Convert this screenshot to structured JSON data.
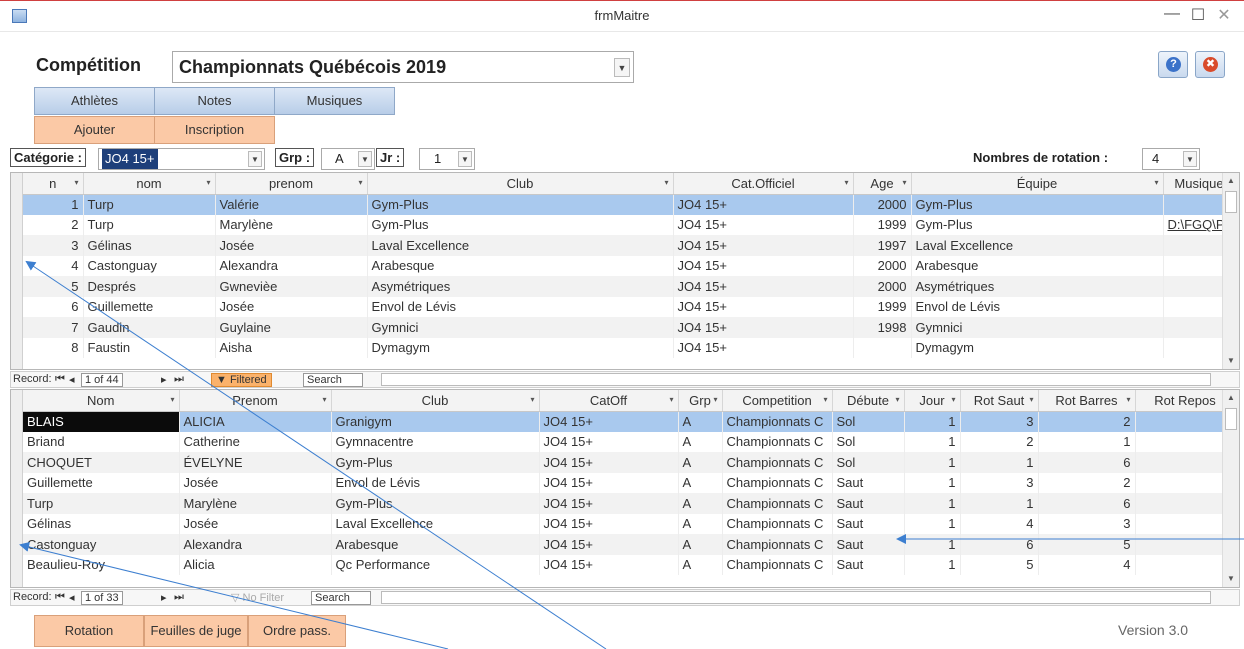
{
  "window": {
    "title": "frmMaitre",
    "minimize": "—",
    "maximize": "☐",
    "close": "✕"
  },
  "header": {
    "competition_label": "Compétition",
    "competition_value": "Championnats Québécois 2019",
    "help_icon": "?",
    "close_icon": "✖"
  },
  "buttons": {
    "athletes": "Athlètes",
    "notes": "Notes",
    "musiques": "Musiques",
    "ajouter": "Ajouter",
    "inscription": "Inscription",
    "rotation": "Rotation",
    "feuilles": "Feuilles de juge",
    "ordre": "Ordre pass."
  },
  "filters": {
    "categorie_label": "Catégorie :",
    "categorie_value": "JO4 15+",
    "grp_label": "Grp :",
    "grp_value": "A",
    "jr_label": "Jr :",
    "jr_value": "1",
    "rotation_label": "Nombres de rotation :",
    "rotation_value": "4"
  },
  "grid1": {
    "columns": [
      "n",
      "nom",
      "prenom",
      "Club",
      "Cat.Officiel",
      "Age",
      "Équipe",
      "Musique"
    ],
    "rows": [
      [
        "1",
        "Turp",
        "Valérie",
        "Gym-Plus",
        "JO4 15+",
        "2000",
        "Gym-Plus",
        ""
      ],
      [
        "2",
        "Turp",
        "Marylène",
        "Gym-Plus",
        "JO4 15+",
        "1999",
        "Gym-Plus",
        "D:\\FGQ\\Prc"
      ],
      [
        "3",
        "Gélinas",
        "Josée",
        "Laval Excellence",
        "JO4 15+",
        "1997",
        "Laval Excellence",
        ""
      ],
      [
        "4",
        "Castonguay",
        "Alexandra",
        "Arabesque",
        "JO4 15+",
        "2000",
        "Arabesque",
        ""
      ],
      [
        "5",
        "Després",
        "Gwnevièe",
        "Asymétriques",
        "JO4 15+",
        "2000",
        "Asymétriques",
        ""
      ],
      [
        "6",
        "Guillemette",
        "Josée",
        "Envol de Lévis",
        "JO4 15+",
        "1999",
        "Envol de Lévis",
        ""
      ],
      [
        "7",
        "Gaudin",
        "Guylaine",
        "Gymnici",
        "JO4 15+",
        "1998",
        "Gymnici",
        ""
      ],
      [
        "8",
        "Faustin",
        "Aisha",
        "Dymagym",
        "JO4 15+",
        "",
        "Dymagym",
        ""
      ]
    ]
  },
  "nav1": {
    "record_label": "Record:",
    "position": "1 of 44",
    "filter_status": "Filtered",
    "search": "Search"
  },
  "grid2": {
    "columns": [
      "Nom",
      "Prenom",
      "Club",
      "CatOff",
      "Grp",
      "Competition",
      "Débute",
      "Jour",
      "Rot Saut",
      "Rot Barres",
      "Rot Repos"
    ],
    "rows": [
      [
        "BLAIS",
        "ALICIA",
        "Granigym",
        "JO4 15+",
        "A",
        "Championnats C",
        "Sol",
        "1",
        "3",
        "2",
        ""
      ],
      [
        "Briand",
        "Catherine",
        "Gymnacentre",
        "JO4 15+",
        "A",
        "Championnats C",
        "Sol",
        "1",
        "2",
        "1",
        ""
      ],
      [
        "CHOQUET",
        "ÉVELYNE",
        "Gym-Plus",
        "JO4 15+",
        "A",
        "Championnats C",
        "Sol",
        "1",
        "1",
        "6",
        ""
      ],
      [
        "Guillemette",
        "Josée",
        "Envol de Lévis",
        "JO4 15+",
        "A",
        "Championnats C",
        "Saut",
        "1",
        "3",
        "2",
        ""
      ],
      [
        "Turp",
        "Marylène",
        "Gym-Plus",
        "JO4 15+",
        "A",
        "Championnats C",
        "Saut",
        "1",
        "1",
        "6",
        ""
      ],
      [
        "Gélinas",
        "Josée",
        "Laval Excellence",
        "JO4 15+",
        "A",
        "Championnats C",
        "Saut",
        "1",
        "4",
        "3",
        ""
      ],
      [
        "Castonguay",
        "Alexandra",
        "Arabesque",
        "JO4 15+",
        "A",
        "Championnats C",
        "Saut",
        "1",
        "6",
        "5",
        ""
      ],
      [
        "Beaulieu-Roy",
        "Alicia",
        "Qc Performance",
        "JO4 15+",
        "A",
        "Championnats C",
        "Saut",
        "1",
        "5",
        "4",
        ""
      ]
    ]
  },
  "nav2": {
    "record_label": "Record:",
    "position": "1 of 33",
    "filter_status": "No Filter",
    "search": "Search"
  },
  "footer": {
    "version": "Version 3.0"
  }
}
